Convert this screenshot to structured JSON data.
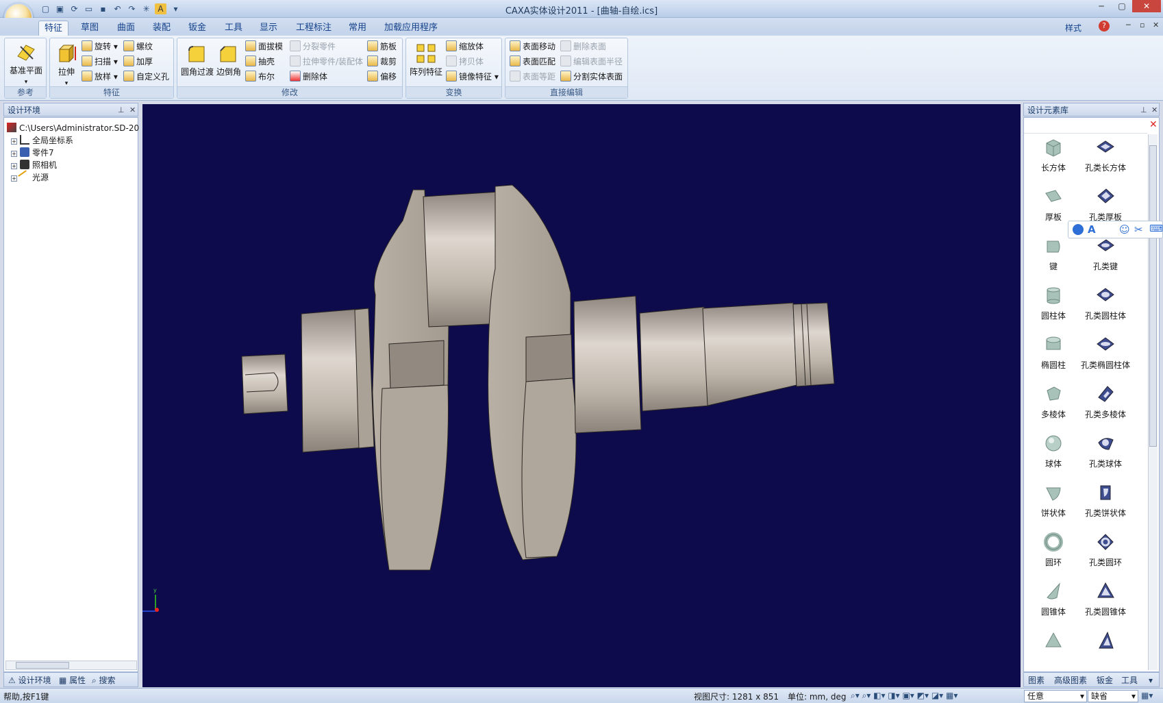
{
  "app": {
    "title": "CAXA实体设计2011 - [曲轴-自绘.ics]"
  },
  "tabs": [
    "特征",
    "草图",
    "曲面",
    "装配",
    "钣金",
    "工具",
    "显示",
    "工程标注",
    "常用",
    "加载应用程序"
  ],
  "ribbon_right": {
    "style_label": "样式"
  },
  "groups": {
    "reference": {
      "label": "参考",
      "datum_plane": "基准平面"
    },
    "feature": {
      "label": "特征",
      "extrude": "拉伸",
      "revolve": "旋转",
      "sweep": "扫描",
      "loft": "放样",
      "thread": "螺纹",
      "thicken": "加厚",
      "custom_hole": "自定义孔"
    },
    "modify": {
      "label": "修改",
      "fillet": "圆角过渡",
      "chamfer": "边倒角",
      "draft": "面拔模",
      "shell": "抽壳",
      "boolean": "布尔",
      "split_part": "分裂零件",
      "pull_part": "拉伸零件/装配体",
      "delete_body": "删除体",
      "rib": "筋板",
      "trim": "裁剪",
      "offset": "偏移"
    },
    "transform": {
      "label": "变换",
      "pattern": "阵列特征",
      "scale": "缩放体",
      "copy": "拷贝体",
      "mirror": "镜像特征"
    },
    "direct_edit": {
      "label": "直接编辑",
      "move_face": "表面移动",
      "delete_face": "删除表面",
      "match_face": "表面匹配",
      "edit_radius": "编辑表面半径",
      "face_offset": "表面等距",
      "split_solid": "分割实体表面"
    }
  },
  "left_panel": {
    "title": "设计环境",
    "root": "C:\\Users\\Administrator.SD-20",
    "items": [
      "全局坐标系",
      "零件7",
      "照相机",
      "光源"
    ],
    "bottom_tabs": [
      "设计环境",
      "属性",
      "搜索"
    ]
  },
  "right_panel": {
    "title": "设计元素库",
    "elements": [
      "长方体",
      "孔类长方体",
      "厚板",
      "孔类厚板",
      "键",
      "孔类键",
      "圆柱体",
      "孔类圆柱体",
      "椭圆柱",
      "孔类椭圆柱体",
      "多棱体",
      "孔类多棱体",
      "球体",
      "孔类球体",
      "饼状体",
      "孔类饼状体",
      "圆环",
      "孔类圆环",
      "圆锥体",
      "孔类圆锥体"
    ],
    "bottom_tabs": [
      "图素",
      "高级图素",
      "钣金",
      "工具"
    ]
  },
  "statusbar": {
    "help": "帮助,按F1键",
    "view_size": "视图尺寸: 1281 x 851",
    "units": "单位: mm, deg",
    "select_mode": "任意",
    "default": "缺省"
  },
  "colors": {
    "viewport_bg": "#0d0b4c",
    "part": "#bdb4a9",
    "ribbon_blue": "#15428b"
  }
}
